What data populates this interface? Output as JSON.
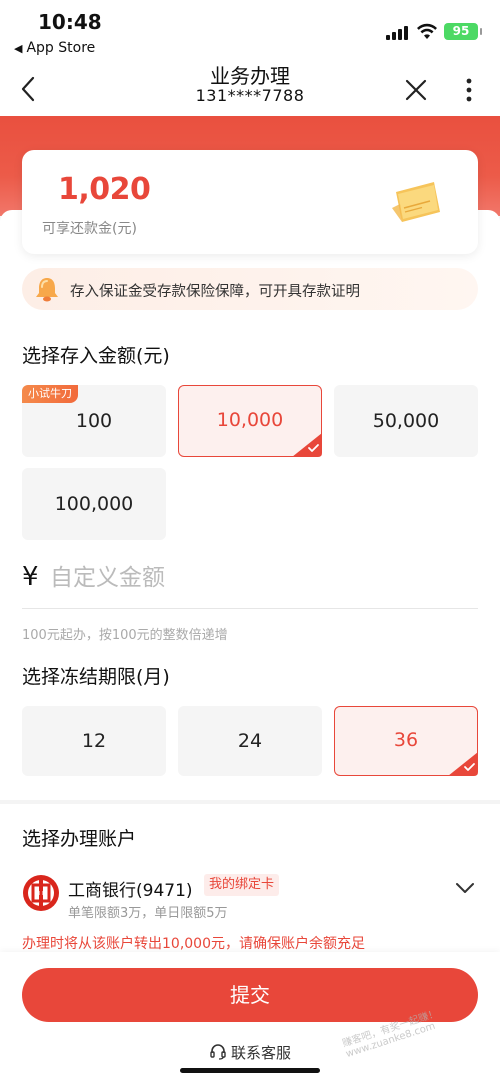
{
  "status_bar": {
    "time": "10:48",
    "back_app": "App Store",
    "battery": "95"
  },
  "nav": {
    "title": "业务办理",
    "subtitle": "131****7788"
  },
  "amount_card": {
    "value": "1,020",
    "label": "可享还款金(元)"
  },
  "notice": {
    "text": "存入保证金受存款保险保障，可开具存款证明"
  },
  "deposit": {
    "title": "选择存入金额(元)",
    "options": [
      {
        "label": "100",
        "tag": "小试牛刀",
        "selected": false
      },
      {
        "label": "10,000",
        "selected": true
      },
      {
        "label": "50,000",
        "selected": false
      },
      {
        "label": "100,000",
        "selected": false
      }
    ],
    "currency_symbol": "¥",
    "custom_placeholder": "自定义金额",
    "hint": "100元起办，按100元的整数倍递增"
  },
  "term": {
    "title": "选择冻结期限(月)",
    "options": [
      {
        "label": "12",
        "selected": false
      },
      {
        "label": "24",
        "selected": false
      },
      {
        "label": "36",
        "selected": true
      }
    ]
  },
  "account": {
    "title": "选择办理账户",
    "bank_name": "工商银行(9471)",
    "bound_tag": "我的绑定卡",
    "limit": "单笔限额3万，单日限额5万",
    "warning": "办理时将从该账户转出10,000元，请确保账户余额充足"
  },
  "submit_label": "提交",
  "service_label": "联系客服",
  "watermark": "赚客吧，有奖一起赚！ www.zuanke8.com",
  "colors": {
    "accent": "#e8473a",
    "selected_bg": "#fdf0ee",
    "tile_bg": "#f5f5f5"
  }
}
